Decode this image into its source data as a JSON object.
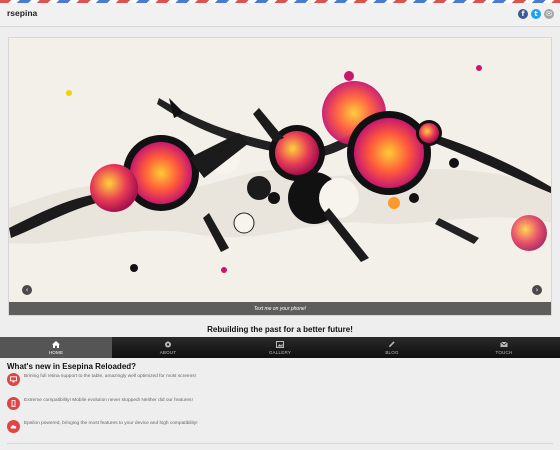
{
  "header": {
    "brand": "rsepina",
    "social": [
      {
        "icon": "facebook-icon",
        "glyph": "f",
        "color": "#3b5998"
      },
      {
        "icon": "twitter-icon",
        "glyph": "t",
        "color": "#1da1f2"
      },
      {
        "icon": "email-icon",
        "glyph": "✉",
        "color": "#a5a5a5"
      }
    ]
  },
  "slider": {
    "caption": "Text me on your phone!",
    "prev_icon": "chevron-left-icon",
    "next_icon": "chevron-right-icon"
  },
  "tagline": "Rebuilding the past for a better future!",
  "nav": {
    "items": [
      {
        "label": "HOME",
        "icon": "home-icon",
        "active": true
      },
      {
        "label": "ABOUT",
        "icon": "gear-icon",
        "active": false
      },
      {
        "label": "GALLERY",
        "icon": "image-icon",
        "active": false
      },
      {
        "label": "BLOG",
        "icon": "pencil-icon",
        "active": false
      },
      {
        "label": "TOUCH",
        "icon": "mail-icon",
        "active": false
      }
    ]
  },
  "features": {
    "title": "What's new in Esepina Reloaded?",
    "items": [
      {
        "text": "Brining full retina support to the table, amazingly well optimized for most screens!",
        "icon": "monitor-icon"
      },
      {
        "text": "Extreme compatibility! Mobile evolution never stopped! Neither did our features!",
        "icon": "mobile-icon"
      },
      {
        "text": "Epsilon powered, bringing the most features to your device and high compatibility!",
        "icon": "cloud-icon"
      }
    ]
  },
  "colors": {
    "accent": "#e04545",
    "nav_bg": "#151515",
    "nav_active": "#555555"
  }
}
